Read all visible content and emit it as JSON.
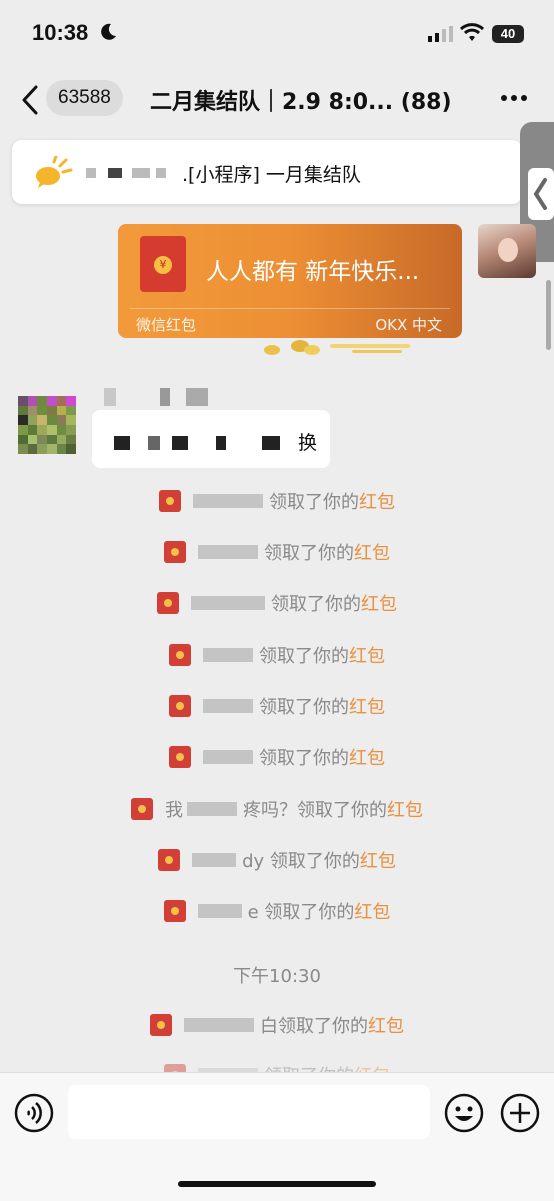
{
  "status_bar": {
    "time": "10:38",
    "battery": "40"
  },
  "nav": {
    "unread_count": "63588",
    "title": "二月集结队｜2.9 8:0...",
    "member_count": "(88)"
  },
  "pinned": {
    "text": ".[小程序] 一月集结队"
  },
  "red_packet_card": {
    "title": "人人都有 新年快乐...",
    "label": "微信红包",
    "brand": "OKX 中文"
  },
  "message": {
    "visible_text": "换"
  },
  "notices": [
    {
      "prefix": "",
      "suffix": "领取了你的",
      "link": "红包"
    },
    {
      "prefix": "",
      "suffix": "领取了你的",
      "link": "红包"
    },
    {
      "prefix": "",
      "suffix": "领取了你的",
      "link": "红包"
    },
    {
      "prefix": "",
      "suffix": "领取了你的",
      "link": "红包"
    },
    {
      "prefix": "",
      "suffix": "领取了你的",
      "link": "红包"
    },
    {
      "prefix": "",
      "suffix": "领取了你的",
      "link": "红包"
    },
    {
      "prefix": "我",
      "suffix": "疼吗？领取了你的",
      "link": "红包"
    },
    {
      "prefix": "",
      "suffix": "dy 领取了你的",
      "link": "红包"
    },
    {
      "prefix": "",
      "suffix": "e 领取了你的",
      "link": "红包"
    },
    {
      "prefix": "",
      "suffix": "白领取了你的",
      "link": "红包"
    },
    {
      "prefix": "",
      "suffix": "领取了你的",
      "link": "红包"
    }
  ],
  "time_separator": "下午10:30",
  "input": {
    "value": ""
  },
  "colors": {
    "accent": "#e8913f",
    "red_packet": "#d23f36",
    "card": "#ed8f34"
  }
}
